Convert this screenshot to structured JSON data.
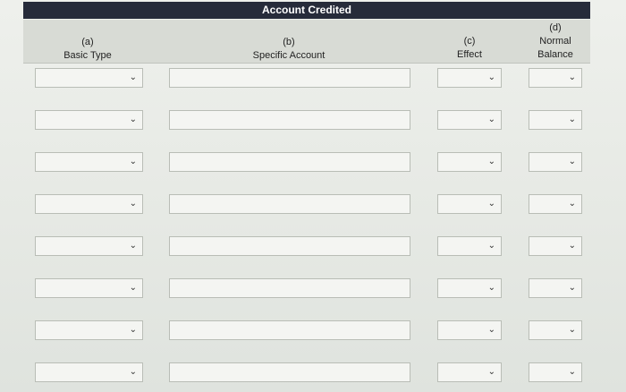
{
  "table": {
    "title": "Account Credited",
    "columns": {
      "a": {
        "letter": "(a)",
        "label": "Basic Type"
      },
      "b": {
        "letter": "(b)",
        "label": "Specific Account"
      },
      "c": {
        "letter": "(c)",
        "label": "Effect"
      },
      "d": {
        "letter": "(d)",
        "label_line1": "Normal",
        "label_line2": "Balance"
      }
    },
    "row_count": 8,
    "dropdown_icon": "chevron-down-icon",
    "dropdown_glyph": "⌄"
  },
  "colors": {
    "header_bar": "#262b3a",
    "header_text": "#ffffff",
    "column_header_bg": "#d8dbd5",
    "field_bg": "#f4f5f2",
    "field_border": "#b9bdb6"
  }
}
